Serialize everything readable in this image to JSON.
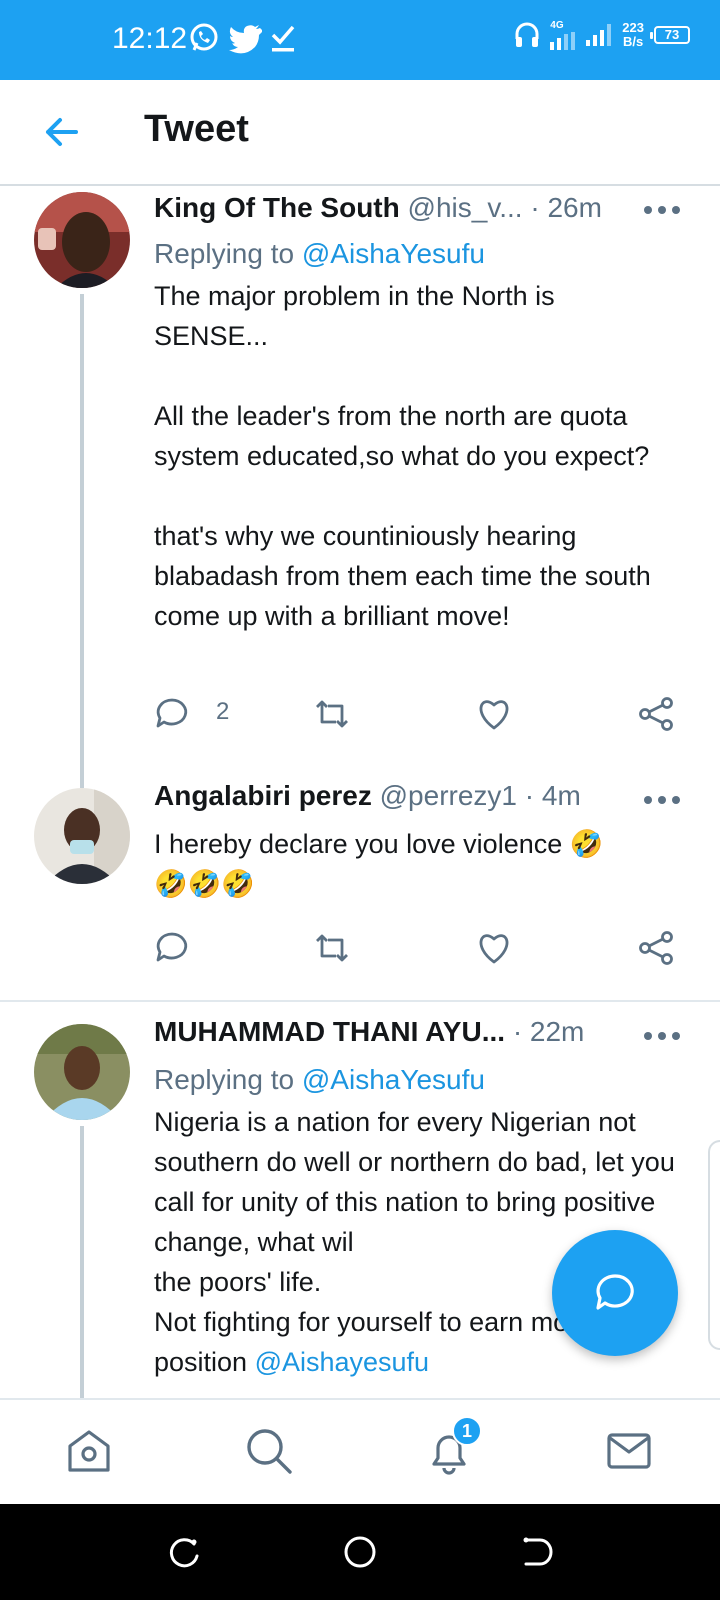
{
  "status_bar": {
    "time": "12:12",
    "network_type": "4G",
    "net_speed_value": "223",
    "net_speed_unit": "B/s",
    "battery": "73",
    "background": "#1da1f2"
  },
  "header": {
    "title": "Tweet"
  },
  "tweets": [
    {
      "author": "King Of The South",
      "handle": "@his_v...",
      "time": " · 26m",
      "replying_prefix": "Replying to ",
      "replying_to": "@AishaYesufu",
      "body": "The major problem in the North is\nSENSE...\n\nAll the leader's from the north are quota system educated,so what do you expect?\n\nthat's why we countiniously hearing blabadash from them each time the south come up with a brilliant move!",
      "reply_count": "2"
    },
    {
      "author": "Angalabiri perez",
      "handle": "@perrezy1",
      "time": " · 4m",
      "body": "I hereby declare you love violence 🤣\n🤣🤣🤣"
    },
    {
      "author": "MUHAMMAD THANI AYU...",
      "handle": "",
      "time": " · 22m",
      "replying_prefix": "Replying to ",
      "replying_to": "@AishaYesufu",
      "body": "Nigeria is a nation for every Nigerian not southern do well or northern do bad, let you call for unity of this nation to bring positive change, what wil\nthe poors' life.\nNot fighting for yourself to earn money or position ",
      "body_mention": "@Aishayesufu"
    }
  ],
  "bottom_nav": {
    "notification_badge": "1"
  },
  "colors": {
    "accent": "#1da1f2",
    "link": "#1b95e0",
    "muted": "#5b7083"
  }
}
